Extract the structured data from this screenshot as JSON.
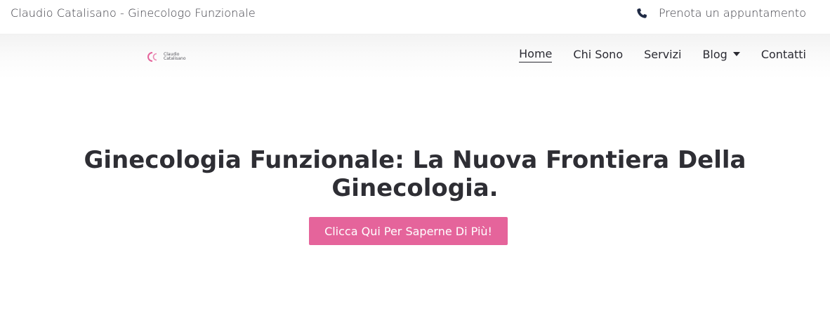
{
  "topbar": {
    "tagline": "Claudio Catalisano - Ginecologo Funzionale",
    "booking_label": "Prenota un appuntamento",
    "booking_icon": "phone-icon"
  },
  "logo": {
    "line1": "Claudio",
    "line2": "Catalisano",
    "color": "#e5649b"
  },
  "nav": {
    "items": [
      {
        "label": "Home",
        "active": true
      },
      {
        "label": "Chi Sono"
      },
      {
        "label": "Servizi"
      },
      {
        "label": "Blog",
        "has_dropdown": true
      },
      {
        "label": "Contatti"
      }
    ]
  },
  "hero": {
    "title": "Ginecologia Funzionale: La Nuova Frontiera Della Ginecologia.",
    "cta_label": "Clicca Qui Per Saperne Di Più!",
    "cta_color": "#e5649b"
  }
}
